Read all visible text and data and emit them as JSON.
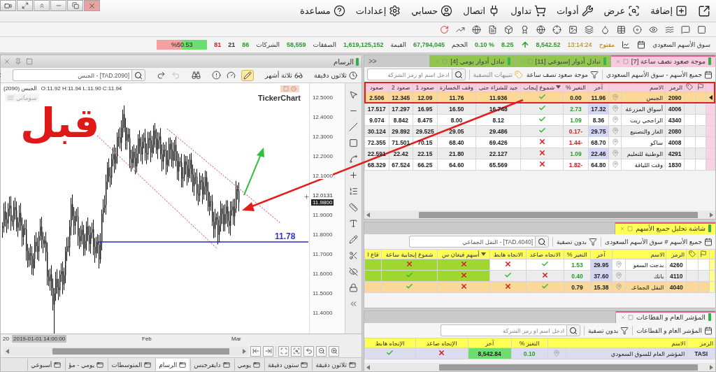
{
  "menu": {
    "items": [
      {
        "label": "إضافة"
      },
      {
        "label": "عرض"
      },
      {
        "label": "أدوات"
      },
      {
        "label": "تداول"
      },
      {
        "label": "اتصال"
      },
      {
        "label": "حسابي"
      },
      {
        "label": "إعدادات"
      },
      {
        "label": "مساعدة"
      }
    ]
  },
  "market_bar": {
    "market": "سوق الأسهم السعودي",
    "status": "مفتوح",
    "time": "13:14:24",
    "index": "8,542.52",
    "change": "8.25",
    "change_pct": "0.10 %",
    "volume_label": "الحجم",
    "volume": "67,794,045",
    "value_label": "القيمة",
    "value": "1,619,125,152",
    "trades_label": "الصفقات",
    "trades": "58,559",
    "companies_label": "الشركات",
    "up": "86",
    "flat": "21",
    "down": "81",
    "ratio": {
      "text": "%50.53",
      "level": 0.5053
    }
  },
  "chart_panel": {
    "title": "الرسام",
    "interval": "ثلاثون دقيقة",
    "period": "ثلاثة أشهر",
    "search_value": "[TAD.2090] - الجبس",
    "symbol": "الجبس (2090)",
    "ohlc": "O:11.92  H:11.94  L:11.90  C:11.94",
    "legend": "سوماتي",
    "logo": "TickerChart",
    "annotation": "قبل",
    "level_line": "11.78",
    "price_ticks_upper": [
      "12.5000",
      "12.4000",
      "12.3000",
      "12.2000",
      "12.1000"
    ],
    "price_tags": [
      {
        "text": "12.0131",
        "kind": "plain"
      },
      {
        "text": "11.9800",
        "kind": "dark"
      }
    ],
    "price_ticks_lower": [
      "11.9000",
      "11.8000",
      "11.7000",
      "11.6000",
      "11.5000",
      "11.4000"
    ],
    "x_labels": [
      "Mar",
      "Feb",
      "20"
    ],
    "cursor_time": "2019-01-01 14:00:00"
  },
  "timeframe_tabs": [
    {
      "label": "ثلاثون دقيقة",
      "selected": false
    },
    {
      "label": "ستون دقيقة",
      "selected": false
    },
    {
      "label": "يومي",
      "selected": false
    },
    {
      "label": "دايفرجنس",
      "selected": false
    },
    {
      "label": "الرسام",
      "selected": true
    },
    {
      "label": "المتوسطات",
      "selected": false
    },
    {
      "label": "يومي - مؤ",
      "selected": false
    },
    {
      "label": "أسبوعي",
      "selected": false
    }
  ],
  "scanner": {
    "collapse": "<<",
    "tabs": [
      {
        "label": "موجة صعود نصف ساعة [7]",
        "selected": true,
        "color": "#f9c9dc"
      },
      {
        "label": "تبادل أدوار إسبوعي [11]",
        "selected": false,
        "color": "#8cc63f"
      },
      {
        "label": "تبادل أدوار يومي [4]",
        "selected": false,
        "color": "#8cc63f"
      }
    ],
    "market": "جميع الأسهم - سوق الأسهم السعودي",
    "filter": "موجة صعود نصف ساعة",
    "alerts": "تنبيهات التصفية",
    "search_placeholder": "ادخل اسم او رمز الشركة",
    "columns": [
      {
        "label": "الرمز",
        "sorted": false
      },
      {
        "label": "الاسم",
        "sorted": false
      },
      {
        "label": "آخر",
        "sorted": false
      },
      {
        "label": "التغير %",
        "sorted": false
      },
      {
        "label": "شموع إيجاب",
        "sorted": true
      },
      {
        "label": "جيد للشراء حتى",
        "sorted": false
      },
      {
        "label": "وقف الخسارة",
        "sorted": false
      },
      {
        "label": "صعود 1",
        "sorted": false
      },
      {
        "label": "صعود 2",
        "sorted": false
      },
      {
        "label": "صعود",
        "sorted": false
      }
    ],
    "rows": [
      {
        "symbol": "2090",
        "name": "الجبس",
        "last": "11.96",
        "flash": false,
        "change": "0.00",
        "gain": false,
        "loss": false,
        "positive": true,
        "buy_until": "11.936",
        "stop_loss": "11.76",
        "target1": "12.09",
        "target2": "12.345",
        "target3": "2.506",
        "selected": true
      },
      {
        "symbol": "4006",
        "name": "أسواق المزرعة",
        "last": "17.32",
        "flash": true,
        "change": "2.73",
        "gain": true,
        "loss": false,
        "positive": true,
        "buy_until": "16.748",
        "stop_loss": "16.50",
        "target1": "16.95",
        "target2": "17.297",
        "target3": "17.517",
        "selected": false
      },
      {
        "symbol": "4340",
        "name": "الراجحي ريت",
        "last": "8.36",
        "flash": false,
        "change": "1.09",
        "gain": true,
        "loss": false,
        "positive": true,
        "buy_until": "8.12",
        "stop_loss": "8.00",
        "target1": "8.475",
        "target2": "8.842",
        "target3": "9.074",
        "selected": false
      },
      {
        "symbol": "2080",
        "name": "الغاز والتصنيع",
        "last": "29.75",
        "flash": true,
        "change": "0.17-",
        "gain": false,
        "loss": true,
        "positive": true,
        "buy_until": "29.486",
        "stop_loss": "29.05",
        "target1": "29.525",
        "target2": "29.892",
        "target3": "30.124",
        "selected": false
      },
      {
        "symbol": "4008",
        "name": "ساكو",
        "last": "68.70",
        "flash": false,
        "change": "1.44-",
        "gain": false,
        "loss": true,
        "positive": false,
        "buy_until": "69.426",
        "stop_loss": "68.40",
        "target1": "70.15",
        "target2": "71.501",
        "target3": "72.355",
        "selected": false
      },
      {
        "symbol": "4291",
        "name": "الوطنية للتعليم",
        "last": "22.46",
        "flash": true,
        "change": "1.09",
        "gain": true,
        "loss": false,
        "positive": false,
        "buy_until": "22.127",
        "stop_loss": "21.80",
        "target1": "22.15",
        "target2": "22.42",
        "target3": "22.591",
        "selected": false
      },
      {
        "symbol": "1830",
        "name": "وقت اللياقة",
        "last": "64.80",
        "flash": false,
        "change": "1.82-",
        "gain": false,
        "loss": true,
        "positive": false,
        "buy_until": "65.569",
        "stop_loss": "64.60",
        "target1": "66.25",
        "target2": "67.524",
        "target3": "68.329",
        "selected": false
      }
    ]
  },
  "analysis": {
    "tab": "شاشة تحليل جميع الأسهم",
    "market": "جميع الأسهم # سوق الأسهم السعودى",
    "filter": "بدون تصفية",
    "search_value": "[TAD.4040] - النقل الجماعي",
    "columns": [
      {
        "label": "الرمز",
        "sorted": false
      },
      {
        "label": "الاسم",
        "sorted": false
      },
      {
        "label": "آخر",
        "sorted": false
      },
      {
        "label": "التغير %",
        "sorted": false
      },
      {
        "label": "الاتجاه صاعد",
        "sorted": false,
        "highlight": false
      },
      {
        "label": "الاتجاه هابط",
        "sorted": false,
        "highlight": false
      },
      {
        "label": "أسهم فيغان س",
        "sorted": true,
        "highlight": true
      },
      {
        "label": "شموع إيجابية ساعة",
        "sorted": false,
        "highlight": true
      },
      {
        "label": "قاع ا",
        "sorted": false,
        "highlight": true
      }
    ],
    "rows": [
      {
        "symbol": "4260",
        "name": "بدجت السعو",
        "last": "29.95",
        "flash": true,
        "change": "1.53",
        "gain": true,
        "loss": false,
        "uptrend": true,
        "downtrend": false,
        "signal1": false,
        "signal2": false,
        "selected": false
      },
      {
        "symbol": "4110",
        "name": "باتك",
        "last": "37.60",
        "flash": true,
        "change": "0.40",
        "gain": true,
        "loss": false,
        "uptrend": false,
        "downtrend": true,
        "signal1": false,
        "signal2": true,
        "selected": false
      },
      {
        "symbol": "4040",
        "name": "النقل الجماعـ",
        "last": "15.38",
        "flash": false,
        "change": "0.79",
        "gain": false,
        "loss": false,
        "uptrend": true,
        "downtrend": false,
        "signal1": false,
        "signal2": true,
        "selected": true
      }
    ]
  },
  "index_panel": {
    "tab": "المؤشر العام و القطاعات",
    "market": "المؤشر العام و القطاعات",
    "filter": "بدون تصفية",
    "search_placeholder": "ادخل اسم او رمز الشركة",
    "columns": [
      "الرمز",
      "الاسم",
      "التغير %",
      "آخر",
      "الإتجاه صاعد",
      "الإتجاه هابط"
    ],
    "rows": [
      {
        "symbol": "TASI",
        "name": "المؤشر العام للسوق السعودي",
        "change": "0.10",
        "last": "8,542.84",
        "flash": true,
        "uptrend": false,
        "downtrend": true
      }
    ]
  }
}
